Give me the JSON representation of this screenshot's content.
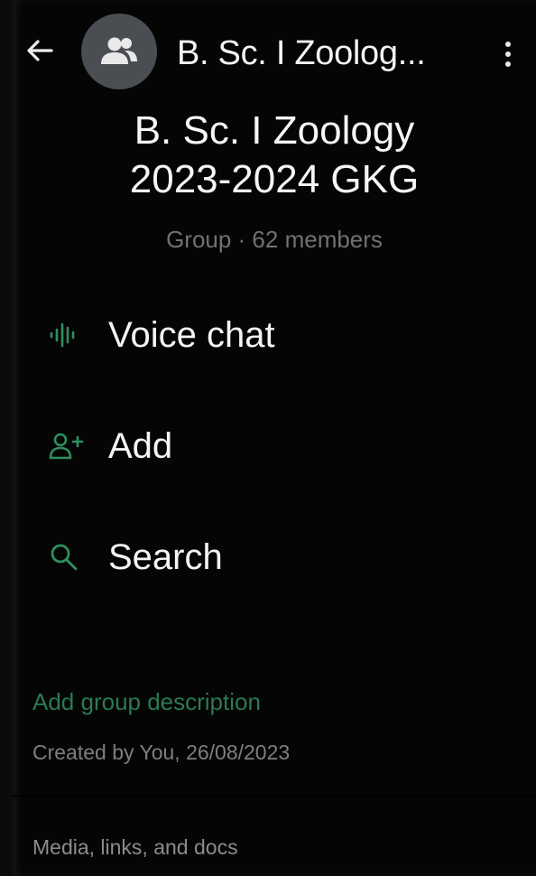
{
  "header": {
    "back_icon": "arrow-left-icon",
    "avatar_icon": "group-icon",
    "title": "B. Sc. I Zoolog...",
    "menu_icon": "more-vertical-icon"
  },
  "group": {
    "name_line1": "B. Sc. I Zoology",
    "name_line2": "2023-2024 GKG",
    "meta": "Group · 62 members"
  },
  "actions": [
    {
      "label": "Voice chat",
      "icon": "voice-waveform-icon"
    },
    {
      "label": "Add",
      "icon": "add-person-icon"
    },
    {
      "label": "Search",
      "icon": "search-icon"
    }
  ],
  "description": {
    "add_label": "Add group description",
    "created_by": "Created by You, 26/08/2023"
  },
  "media": {
    "label": "Media, links, and docs"
  },
  "colors": {
    "background": "#050505",
    "accent_green": "#2a7a53",
    "icon_green": "#2f8f5f",
    "secondary_text": "#6f7275",
    "avatar_bg": "#4a4d52"
  }
}
